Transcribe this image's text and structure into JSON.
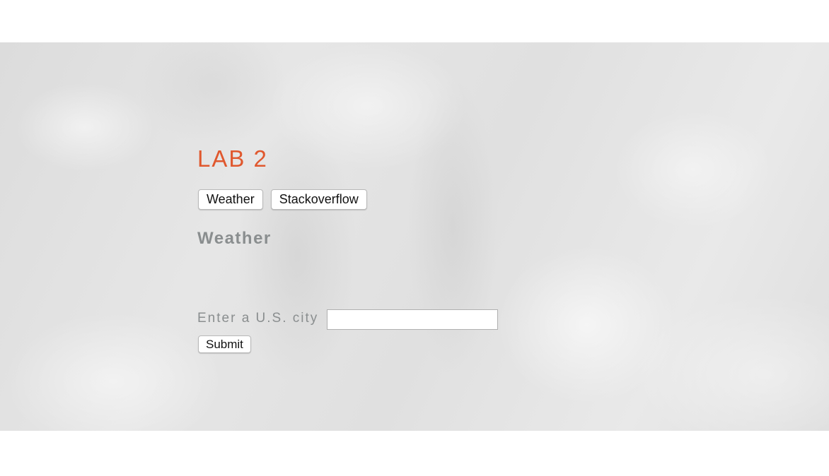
{
  "page": {
    "title": "LAB 2"
  },
  "nav": {
    "items": [
      {
        "label": "Weather"
      },
      {
        "label": "Stackoverflow"
      }
    ]
  },
  "weather": {
    "heading": "Weather",
    "city_label": "Enter a U.S. city",
    "city_value": "",
    "city_placeholder": "",
    "submit_label": "Submit"
  },
  "colors": {
    "title_accent": "#e0582e",
    "heading_gray": "#8a8e8f",
    "background_gray": "#e2e2e2"
  }
}
